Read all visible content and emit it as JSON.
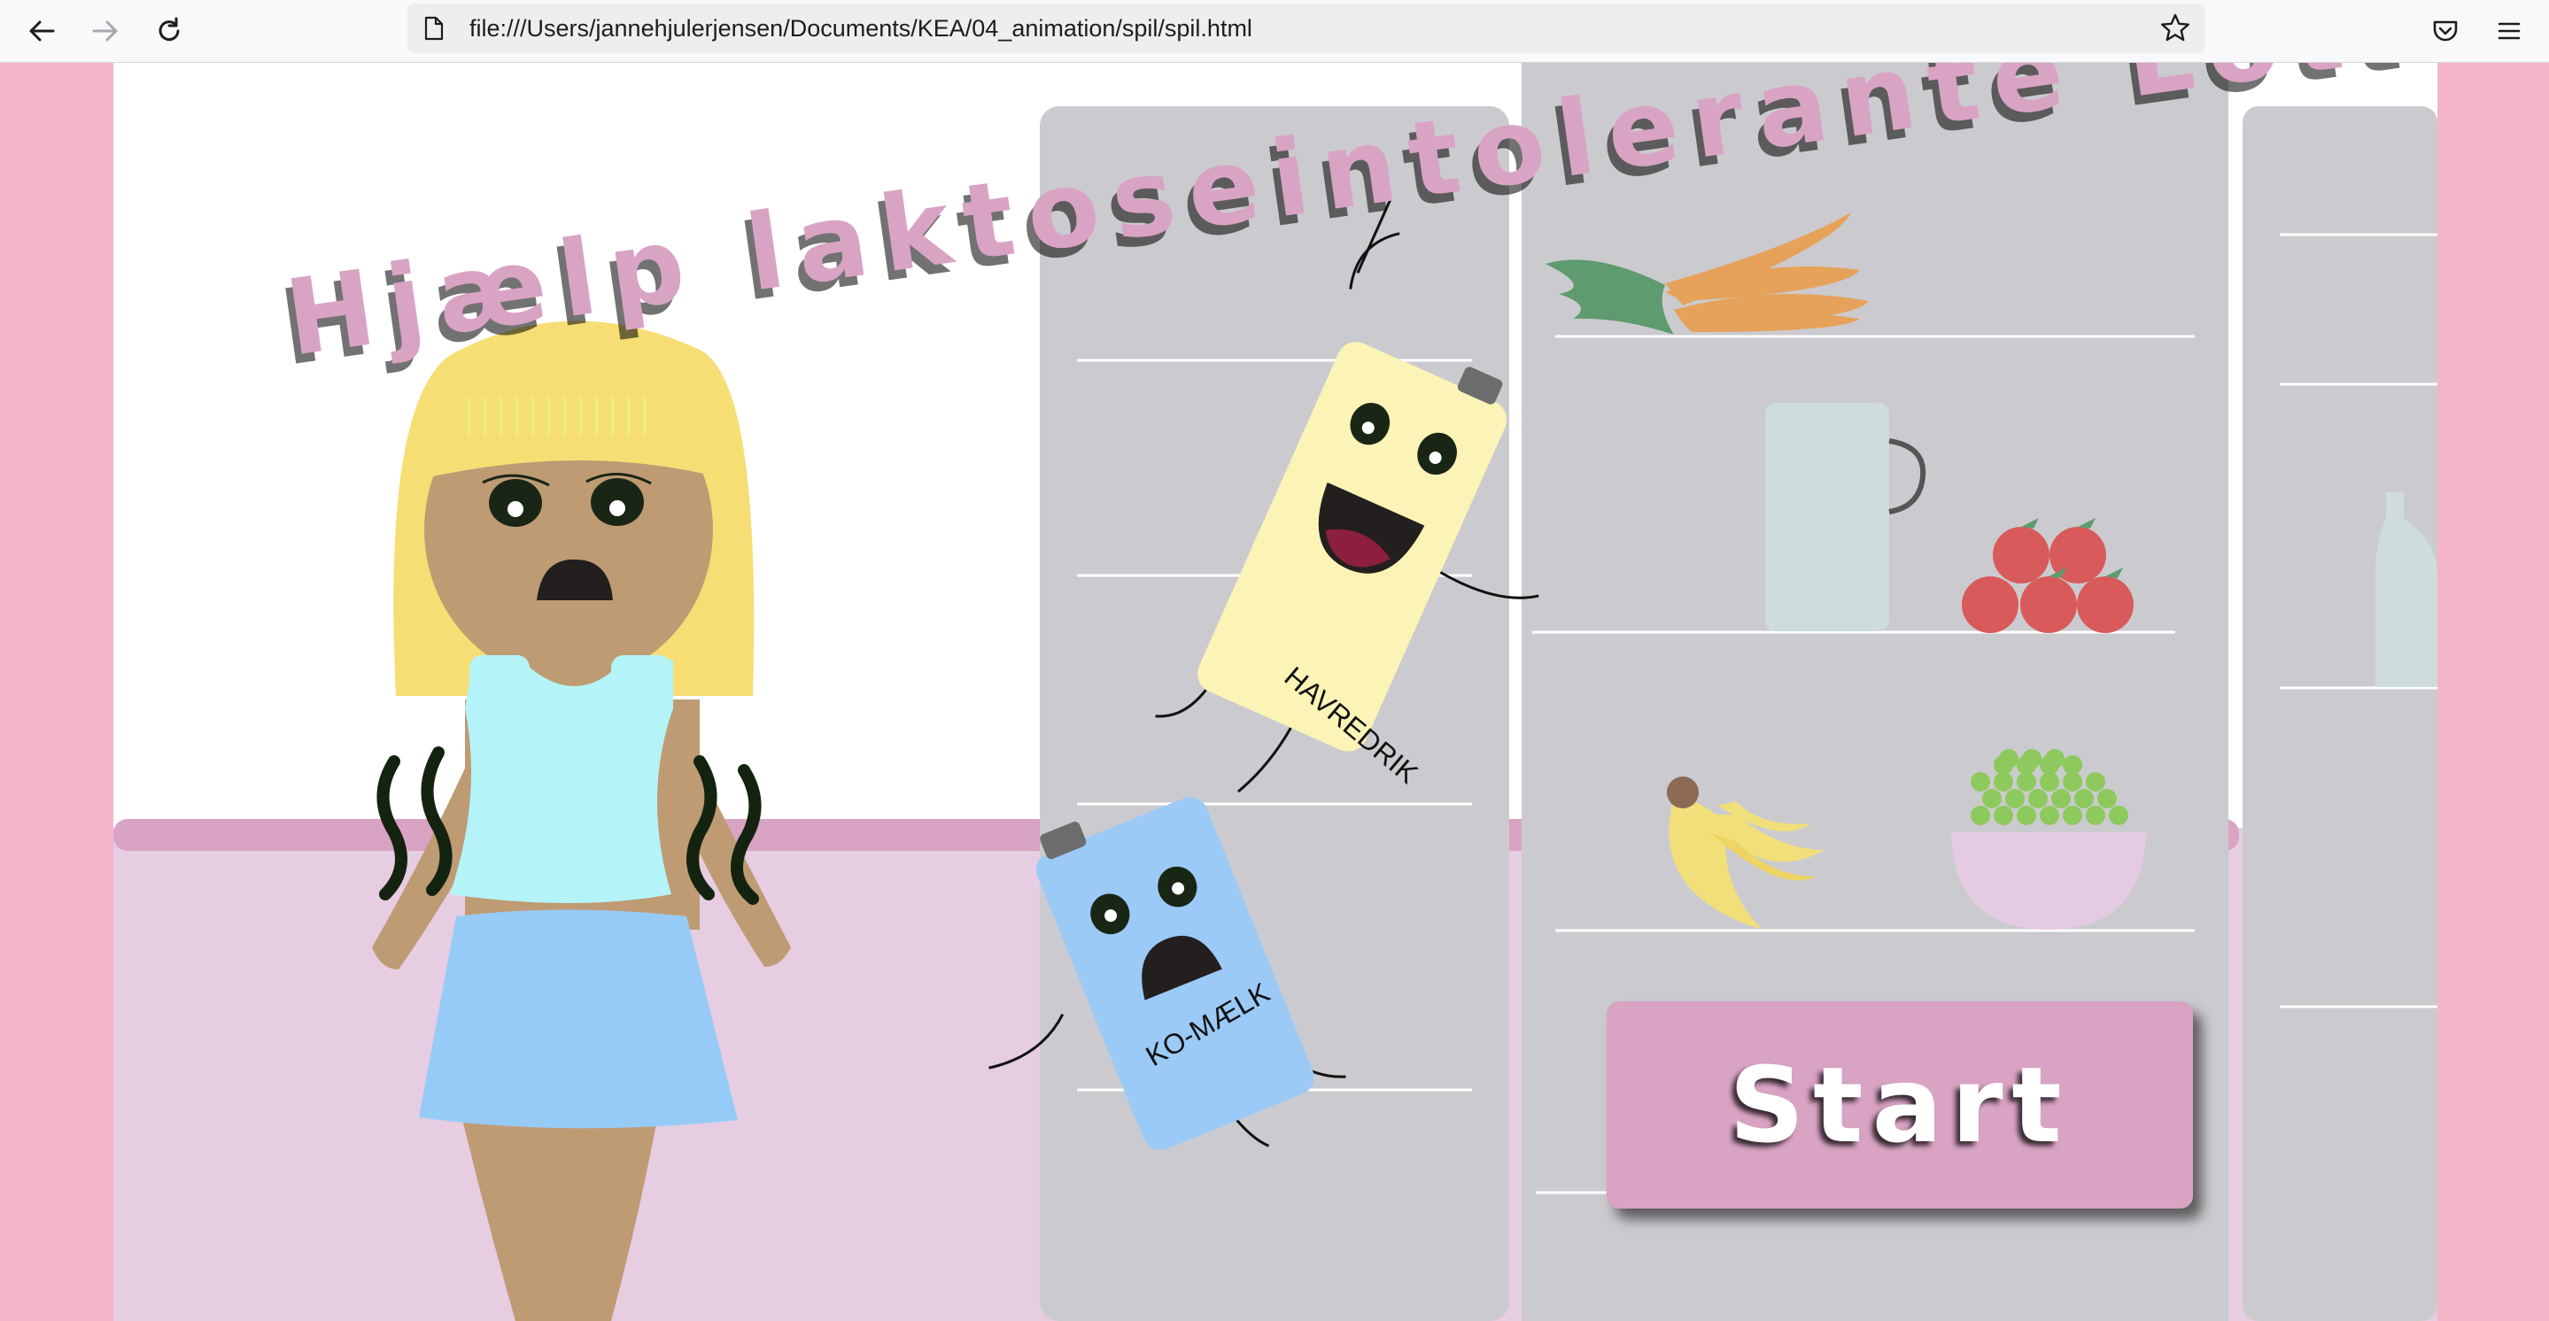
{
  "browser": {
    "url": "file:///Users/jannehjulerjensen/Documents/KEA/04_animation/spil/spil.html",
    "icons": [
      "back-arrow-icon",
      "forward-arrow-icon",
      "reload-icon",
      "page-icon",
      "bookmark-star-icon",
      "pocket-icon",
      "menu-icon"
    ]
  },
  "game": {
    "title": "Hjælp laktoseintolerante Lotte",
    "start_label": "Start",
    "havredrik_label": "HAVREDRIK",
    "komaelk_label": "KO-MÆLK"
  },
  "colors": {
    "side_pink": "#f4b5c8",
    "floor_pink": "#e6cde2",
    "fridge_gray": "#cbcbcf",
    "title_pink": "#d9a3c4",
    "button_pink": "#d9a3c4",
    "hair_yellow": "#f7de74",
    "skin": "#bf9b74",
    "top_blue": "#b4f4f8",
    "skirt_blue": "#97cbf7",
    "havredrik_yellow": "#fcf4b6",
    "komaelk_blue": "#9ccaf6"
  }
}
